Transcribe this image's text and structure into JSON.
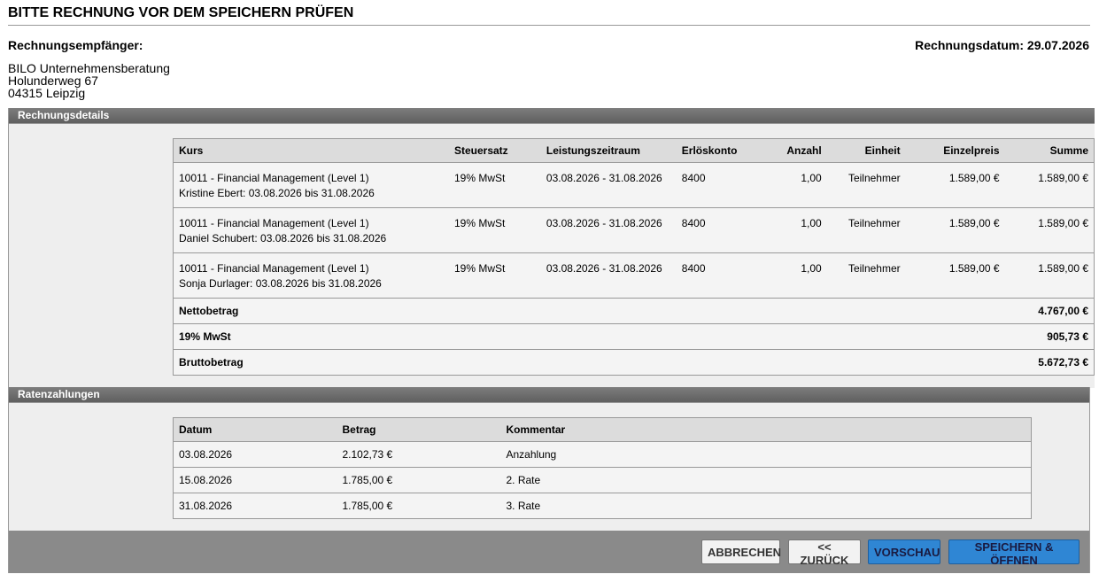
{
  "page_title": "BITTE RECHNUNG VOR DEM SPEICHERN PRÜFEN",
  "recipient_label": "Rechnungsempfänger:",
  "invoice_date": "Rechnungsdatum: 29.07.2026",
  "address": {
    "name": "BILO Unternehmensberatung",
    "street": "Holunderweg 67",
    "city": "04315 Leipzig"
  },
  "details": {
    "header": "Rechnungsdetails",
    "columns": [
      "Kurs",
      "Steuersatz",
      "Leistungszeitraum",
      "Erlöskonto",
      "Anzahl",
      "Einheit",
      "Einzelpreis",
      "Summe"
    ],
    "rows": [
      {
        "course": "10011 - Financial Management (Level 1)",
        "participant": "Kristine Ebert: 03.08.2026 bis 31.08.2026",
        "tax": "19% MwSt",
        "period": "03.08.2026 - 31.08.2026",
        "account": "8400",
        "qty": "1,00",
        "unit": "Teilnehmer",
        "price": "1.589,00 €",
        "total": "1.589,00 €"
      },
      {
        "course": "10011 - Financial Management (Level 1)",
        "participant": "Daniel Schubert: 03.08.2026 bis 31.08.2026",
        "tax": "19% MwSt",
        "period": "03.08.2026 - 31.08.2026",
        "account": "8400",
        "qty": "1,00",
        "unit": "Teilnehmer",
        "price": "1.589,00 €",
        "total": "1.589,00 €"
      },
      {
        "course": "10011 - Financial Management (Level 1)",
        "participant": "Sonja Durlager: 03.08.2026 bis 31.08.2026",
        "tax": "19% MwSt",
        "period": "03.08.2026 - 31.08.2026",
        "account": "8400",
        "qty": "1,00",
        "unit": "Teilnehmer",
        "price": "1.589,00 €",
        "total": "1.589,00 €"
      }
    ],
    "totals": [
      {
        "label": "Nettobetrag",
        "value": "4.767,00 €"
      },
      {
        "label": "19% MwSt",
        "value": "905,73 €"
      },
      {
        "label": "Bruttobetrag",
        "value": "5.672,73 €"
      }
    ]
  },
  "installments": {
    "header": "Ratenzahlungen",
    "columns": [
      "Datum",
      "Betrag",
      "Kommentar"
    ],
    "rows": [
      {
        "date": "03.08.2026",
        "amount": "2.102,73 €",
        "comment": "Anzahlung"
      },
      {
        "date": "15.08.2026",
        "amount": "1.785,00 €",
        "comment": "2. Rate"
      },
      {
        "date": "31.08.2026",
        "amount": "1.785,00 €",
        "comment": "3. Rate"
      }
    ]
  },
  "buttons": {
    "cancel": "ABBRECHEN",
    "back": "<< ZURÜCK",
    "preview": "VORSCHAU",
    "save_open": "SPEICHERN & ÖFFNEN"
  },
  "colors": {
    "header_bar": "#6e6e6e",
    "footer_bar": "#8a8a8a",
    "primary_button": "#2f86d4",
    "panel_background": "#eeeeee"
  }
}
